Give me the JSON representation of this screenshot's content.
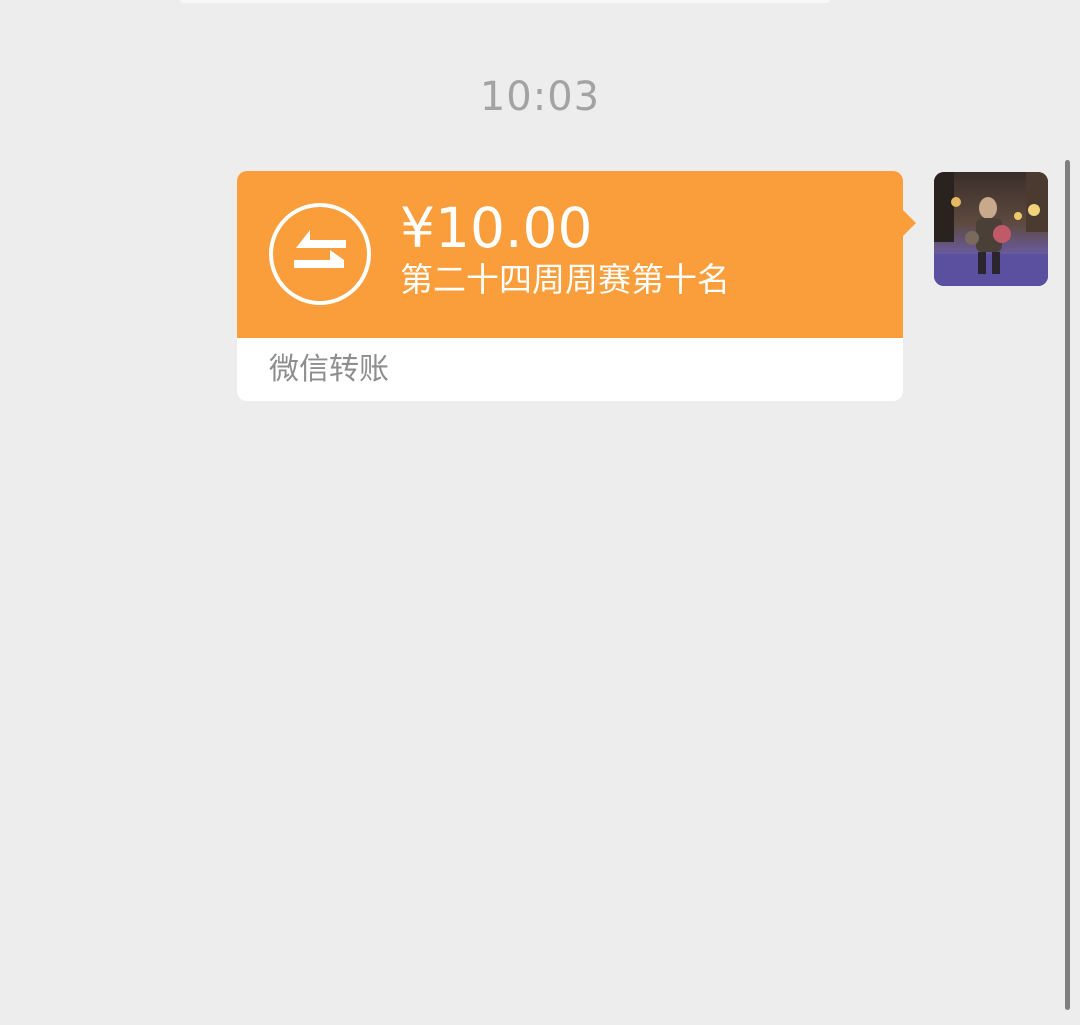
{
  "chat": {
    "timestamp": "10:03"
  },
  "transfer": {
    "amount": "¥10.00",
    "note": "第二十四周周赛第十名",
    "footer_label": "微信转账",
    "icon": "exchange-arrows-icon",
    "accent_color": "#FA9D3B"
  },
  "sender": {
    "avatar": "avatar-photo"
  }
}
